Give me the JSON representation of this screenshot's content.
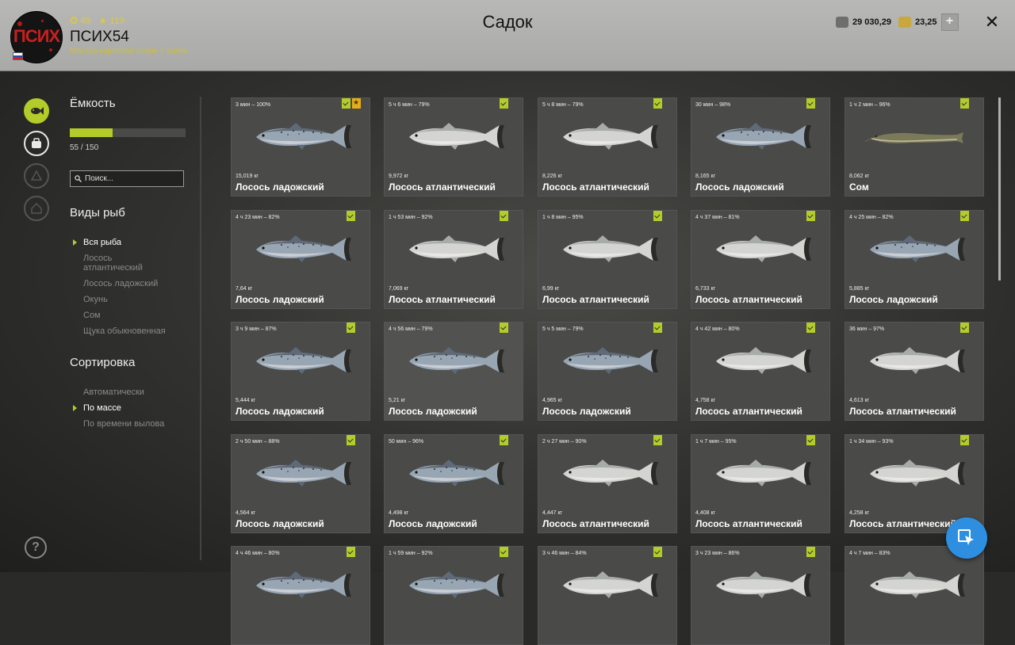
{
  "header": {
    "title": "Садок",
    "avatar_logo": "ПСИХ",
    "stat_a": "49",
    "stat_b": "119",
    "username": "ПСИХ54",
    "rank": "Мастер карповой ловли 7 ранга",
    "silver": "29 030,29",
    "gold": "23,25",
    "plus": "+",
    "close": "✕"
  },
  "sidebar": {
    "capacity_title": "Ёмкость",
    "capacity_value": "55 / 150",
    "capacity_fraction": 0.367,
    "search_placeholder": "Поиск...",
    "species_title": "Виды рыб",
    "species": [
      "Вся рыба",
      "Лосось атлантический",
      "Лосось ладожский",
      "Окунь",
      "Сом",
      "Щука обыкновенная"
    ],
    "species_selected": 0,
    "sort_title": "Сортировка",
    "sort": [
      "Автоматически",
      "По массе",
      "По времени вылова"
    ],
    "sort_selected": 1
  },
  "fish": [
    {
      "time": "3 мин – 100%",
      "weight": "15,019 кг",
      "name": "Лосось ладожский",
      "bookmark": true,
      "kind": "ladoga"
    },
    {
      "time": "5 ч 6 мин – 79%",
      "weight": "9,972 кг",
      "name": "Лосось атлантический",
      "kind": "atlantic"
    },
    {
      "time": "5 ч 8 мин – 79%",
      "weight": "8,226 кг",
      "name": "Лосось атлантический",
      "kind": "atlantic"
    },
    {
      "time": "30 мин – 98%",
      "weight": "8,165 кг",
      "name": "Лосось ладожский",
      "kind": "ladoga"
    },
    {
      "time": "1 ч 2 мин – 96%",
      "weight": "8,062 кг",
      "name": "Сом",
      "kind": "catfish"
    },
    {
      "time": "4 ч 23 мин – 82%",
      "weight": "7,64 кг",
      "name": "Лосось ладожский",
      "kind": "ladoga"
    },
    {
      "time": "1 ч 53 мин – 92%",
      "weight": "7,069 кг",
      "name": "Лосось атлантический",
      "kind": "atlantic"
    },
    {
      "time": "1 ч 8 мин – 95%",
      "weight": "6,99 кг",
      "name": "Лосось атлантический",
      "kind": "atlantic"
    },
    {
      "time": "4 ч 37 мин – 81%",
      "weight": "6,733 кг",
      "name": "Лосось атлантический",
      "kind": "atlantic"
    },
    {
      "time": "4 ч 25 мин – 82%",
      "weight": "5,885 кг",
      "name": "Лосось ладожский",
      "kind": "ladoga"
    },
    {
      "time": "3 ч 9 мин – 87%",
      "weight": "5,444 кг",
      "name": "Лосось ладожский",
      "kind": "ladoga"
    },
    {
      "time": "4 ч 56 мин – 79%",
      "weight": "5,21 кг",
      "name": "Лосось ладожский",
      "kind": "ladoga"
    },
    {
      "time": "5 ч 5 мин – 79%",
      "weight": "4,965 кг",
      "name": "Лосось ладожский",
      "kind": "ladoga"
    },
    {
      "time": "4 ч 42 мин – 80%",
      "weight": "4,758 кг",
      "name": "Лосось атлантический",
      "kind": "atlantic"
    },
    {
      "time": "36 мин – 97%",
      "weight": "4,613 кг",
      "name": "Лосось атлантический",
      "kind": "atlantic"
    },
    {
      "time": "2 ч 50 мин – 88%",
      "weight": "4,564 кг",
      "name": "Лосось ладожский",
      "kind": "ladoga"
    },
    {
      "time": "50 мин – 96%",
      "weight": "4,498 кг",
      "name": "Лосось ладожский",
      "kind": "ladoga"
    },
    {
      "time": "2 ч 27 мин – 90%",
      "weight": "4,447 кг",
      "name": "Лосось атлантический",
      "kind": "atlantic"
    },
    {
      "time": "1 ч 7 мин – 95%",
      "weight": "4,408 кг",
      "name": "Лосось атлантический",
      "kind": "atlantic"
    },
    {
      "time": "1 ч 34 мин – 93%",
      "weight": "4,258 кг",
      "name": "Лосось атлантический",
      "kind": "atlantic"
    },
    {
      "time": "4 ч 46 мин – 80%",
      "weight": "",
      "name": "",
      "kind": "ladoga"
    },
    {
      "time": "1 ч 59 мин – 92%",
      "weight": "",
      "name": "",
      "kind": "ladoga"
    },
    {
      "time": "3 ч 46 мин – 84%",
      "weight": "",
      "name": "",
      "kind": "atlantic"
    },
    {
      "time": "3 ч 23 мин – 86%",
      "weight": "",
      "name": "",
      "kind": "atlantic"
    },
    {
      "time": "4 ч 7 мин – 83%",
      "weight": "",
      "name": "",
      "kind": "atlantic"
    }
  ],
  "help": "?"
}
